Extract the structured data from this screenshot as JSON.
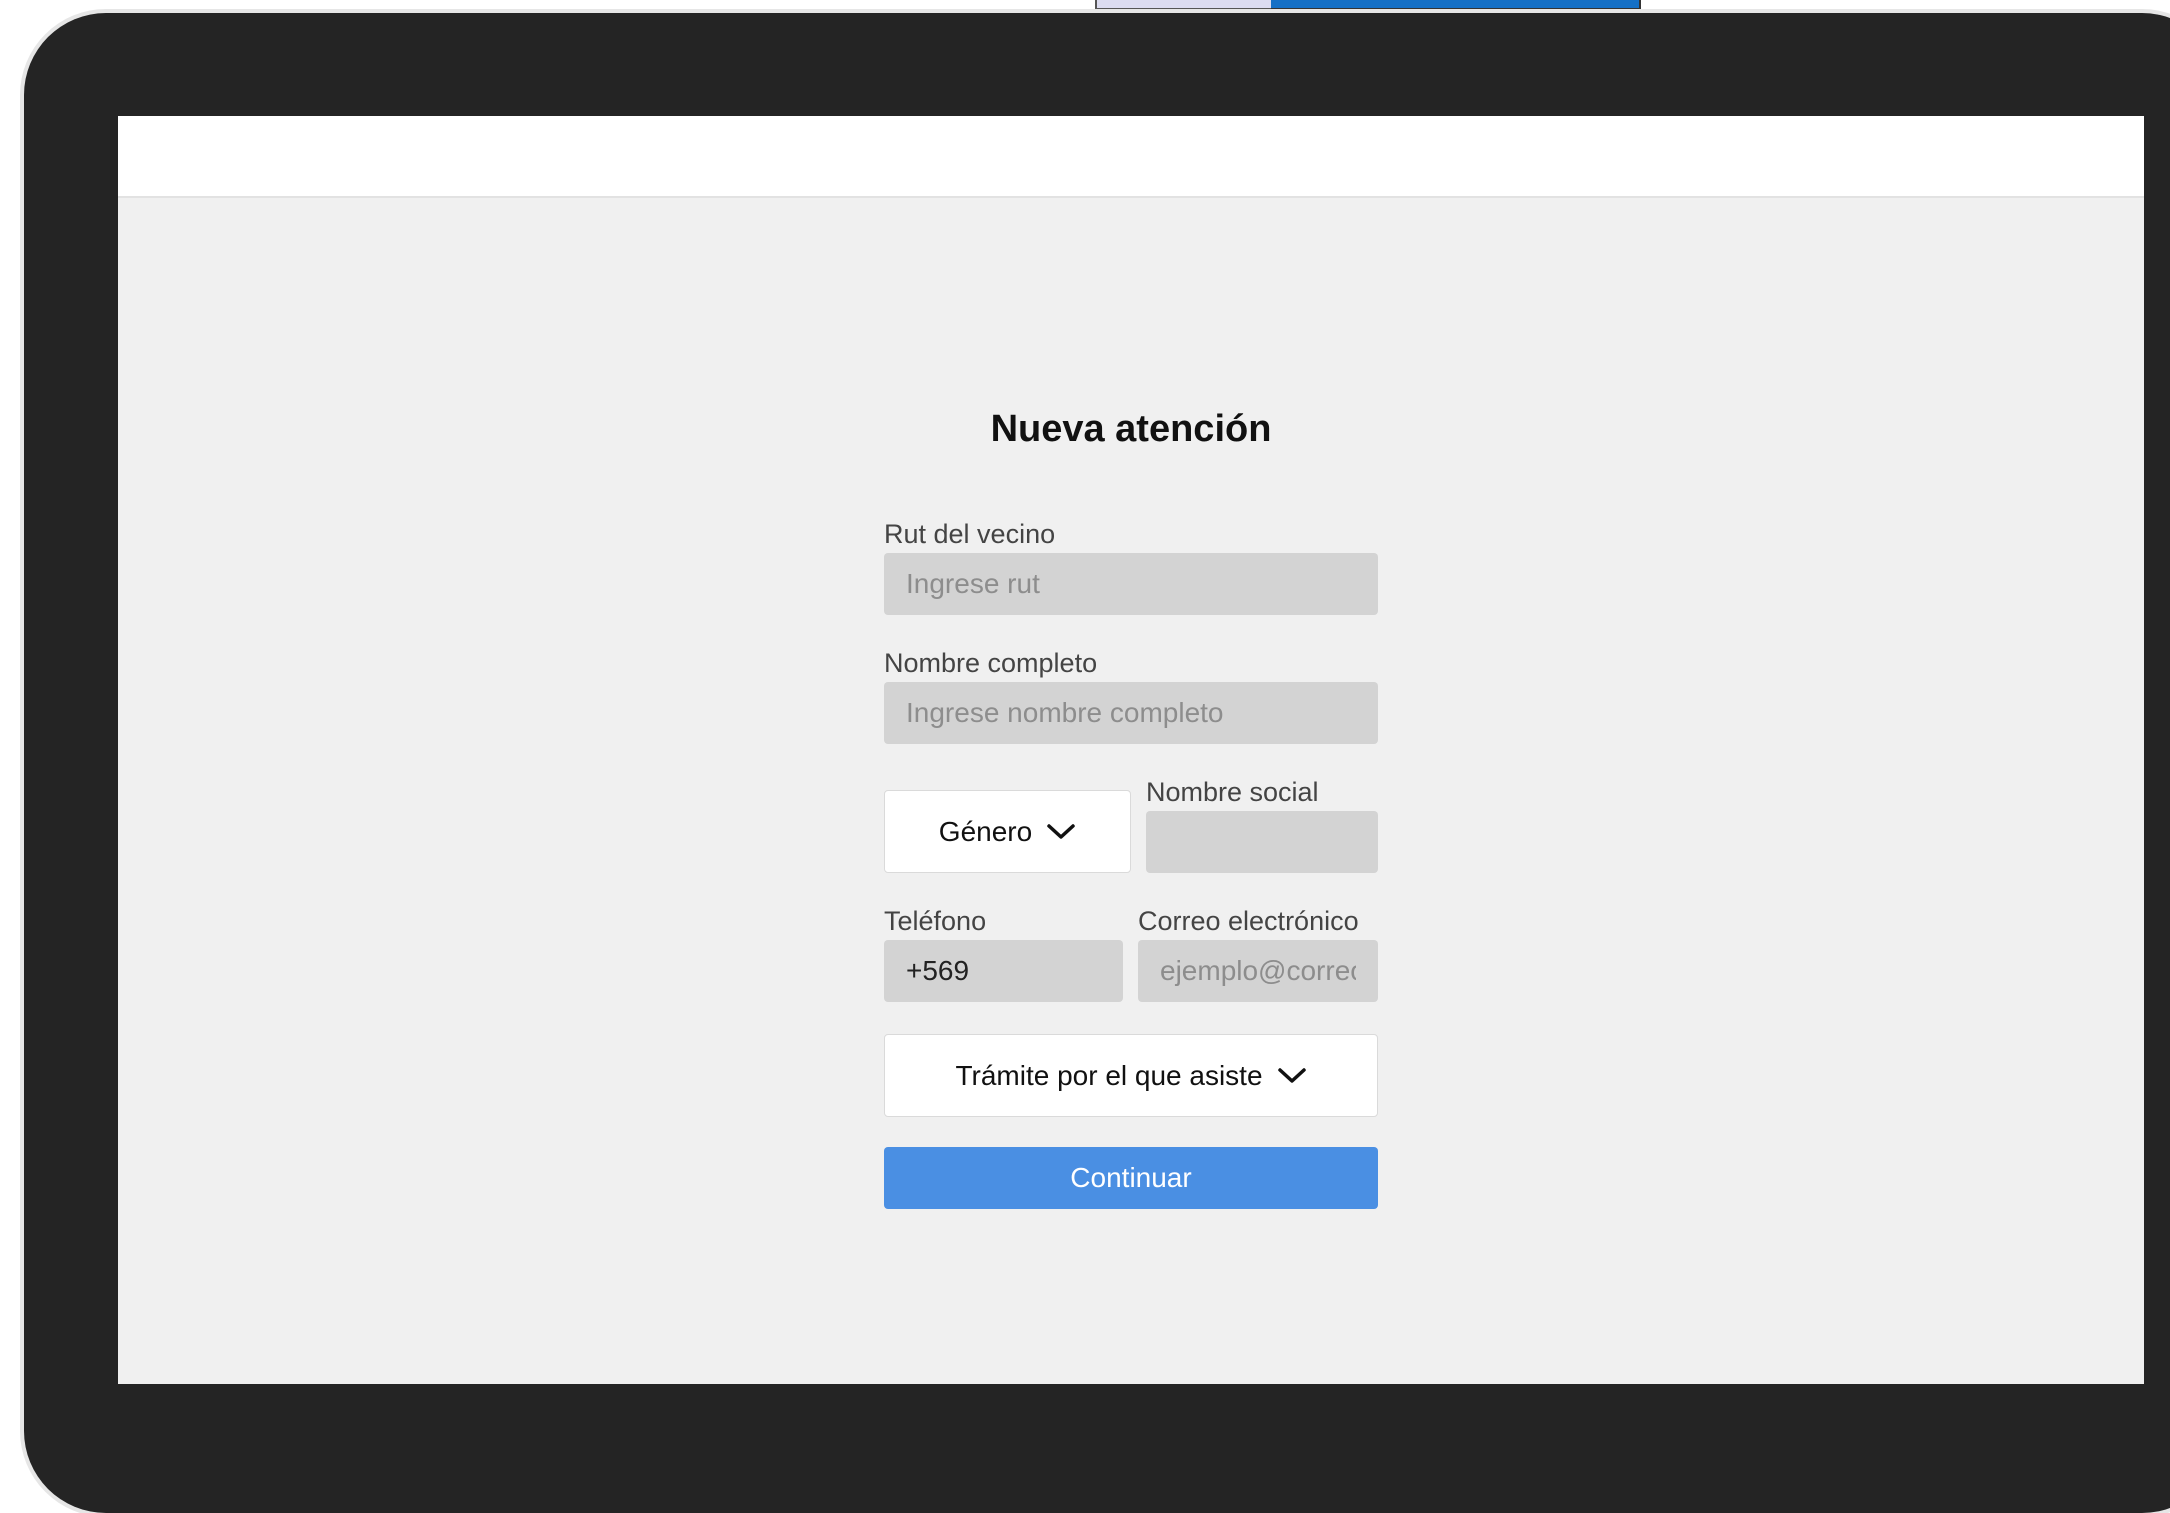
{
  "form": {
    "title": "Nueva atención",
    "rut": {
      "label": "Rut del vecino",
      "placeholder": "Ingrese rut"
    },
    "nombre": {
      "label": "Nombre completo",
      "placeholder": "Ingrese nombre completo"
    },
    "genero": {
      "selected": "Género"
    },
    "nombre_social": {
      "label": "Nombre social",
      "placeholder": ""
    },
    "telefono": {
      "label": "Teléfono",
      "value": "+569"
    },
    "correo": {
      "label": "Correo electrónico",
      "placeholder": "ejemplo@correo.cl"
    },
    "tramite": {
      "selected": "Trámite por el que asiste"
    },
    "continue_label": "Continuar"
  },
  "colors": {
    "device_frame": "#242424",
    "screen_bg": "#f0f0f0",
    "input_bg": "#d3d3d3",
    "primary_button": "#4a8fe3",
    "top_tab_light": "#dcdcf0",
    "top_tab_blue": "#1570c6"
  },
  "icons": {
    "dropdown": "chevron-down-icon"
  }
}
